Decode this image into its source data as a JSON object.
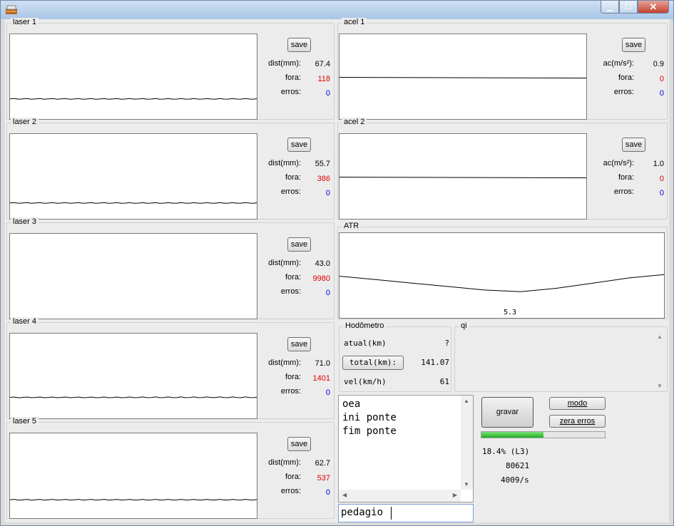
{
  "window": {
    "title": "",
    "close_glyph": "✕",
    "minimize_glyph": "▁",
    "maximize_glyph": "☐"
  },
  "lasers": [
    {
      "label": "laser 1",
      "save": "save",
      "dist_label": "dist(mm):",
      "dist": "67.4",
      "fora_label": "fora:",
      "fora": "118",
      "erros_label": "erros:",
      "erros": "0",
      "level": 0.75
    },
    {
      "label": "laser 2",
      "save": "save",
      "dist_label": "dist(mm):",
      "dist": "55.7",
      "fora_label": "fora:",
      "fora": "386",
      "erros_label": "erros:",
      "erros": "0",
      "level": 0.8
    },
    {
      "label": "laser 3",
      "save": "save",
      "dist_label": "dist(mm):",
      "dist": "43.0",
      "fora_label": "fora:",
      "fora": "9980",
      "erros_label": "erros:",
      "erros": "0",
      "level": null
    },
    {
      "label": "laser 4",
      "save": "save",
      "dist_label": "dist(mm):",
      "dist": "71.0",
      "fora_label": "fora:",
      "fora": "1401",
      "erros_label": "erros:",
      "erros": "0",
      "level": 0.74
    },
    {
      "label": "laser 5",
      "save": "save",
      "dist_label": "dist(mm):",
      "dist": "62.7",
      "fora_label": "fora:",
      "fora": "537",
      "erros_label": "erros:",
      "erros": "0",
      "level": 0.77
    }
  ],
  "acels": [
    {
      "label": "acel 1",
      "save": "save",
      "ac_label": "ac(m/s²):",
      "ac": "0.9",
      "fora_label": "fora:",
      "fora": "0",
      "erros_label": "erros:",
      "erros": "0",
      "level": 0.5
    },
    {
      "label": "acel 2",
      "save": "save",
      "ac_label": "ac(m/s²):",
      "ac": "1.0",
      "fora_label": "fora:",
      "fora": "0",
      "erros_label": "erros:",
      "erros": "0",
      "level": 0.5
    }
  ],
  "atr": {
    "label": "ATR",
    "value": "5.3",
    "profile": [
      0.5,
      0.54,
      0.58,
      0.62,
      0.66,
      0.68,
      0.64,
      0.58,
      0.52,
      0.48
    ]
  },
  "hodometro": {
    "label": "Hodômetro",
    "atual_label": "atual(km)",
    "atual": "?",
    "total_label": "total(km):",
    "total": "141.07",
    "vel_label": "vel(km/h)",
    "vel": "61"
  },
  "qi": {
    "label": "qi"
  },
  "events": {
    "lines": [
      "oea",
      "ini ponte",
      "fim ponte"
    ],
    "input_value": "pedagio"
  },
  "controls": {
    "gravar": "gravar",
    "modo": "modo",
    "zera_erros": "zera erros",
    "progress": 0.5,
    "status_line1": "18.4% (L3)",
    "status_line2": "80621",
    "status_line3": "4009/s"
  }
}
